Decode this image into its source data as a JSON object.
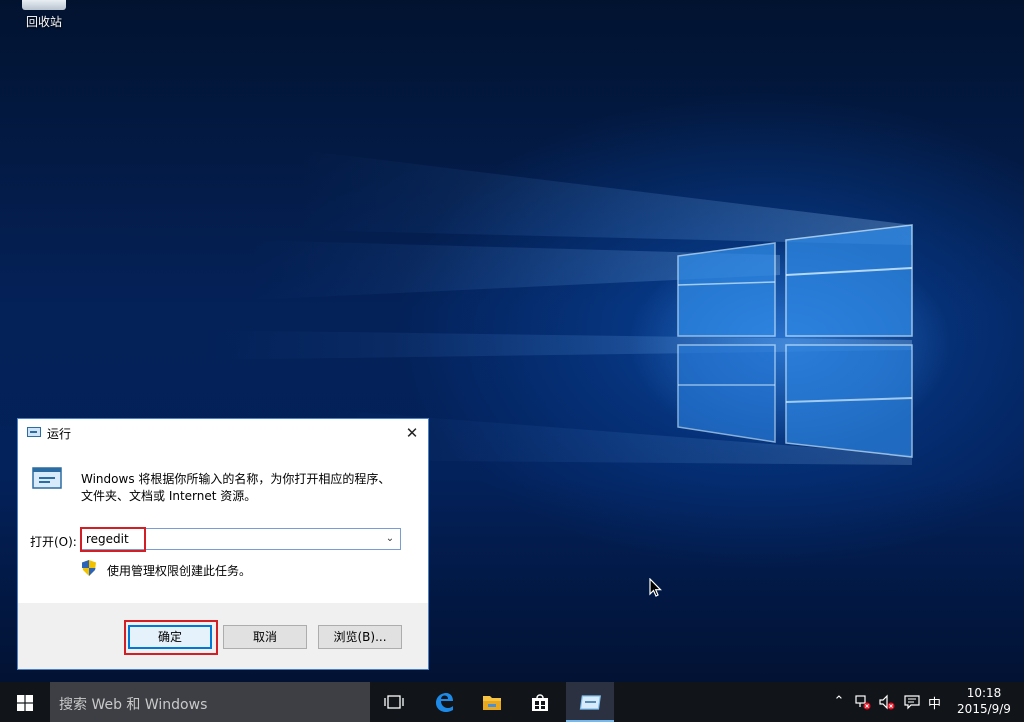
{
  "desktop": {
    "recycle_bin_label": "回收站"
  },
  "run_dialog": {
    "title": "运行",
    "description_line1": "Windows 将根据你所输入的名称，为你打开相应的程序、",
    "description_line2": "文件夹、文档或 Internet 资源。",
    "open_label": "打开(O):",
    "input_value": "regedit",
    "admin_note": "使用管理权限创建此任务。",
    "ok_label": "确定",
    "cancel_label": "取消",
    "browse_label": "浏览(B)...",
    "highlight_color": "#d21f26"
  },
  "taskbar": {
    "search_placeholder": "搜索 Web 和 Windows",
    "icons": [
      "task-view-icon",
      "edge-icon",
      "file-explorer-icon",
      "store-icon",
      "run-icon"
    ],
    "ime_label": "中",
    "time": "10:18",
    "date": "2015/9/9"
  }
}
